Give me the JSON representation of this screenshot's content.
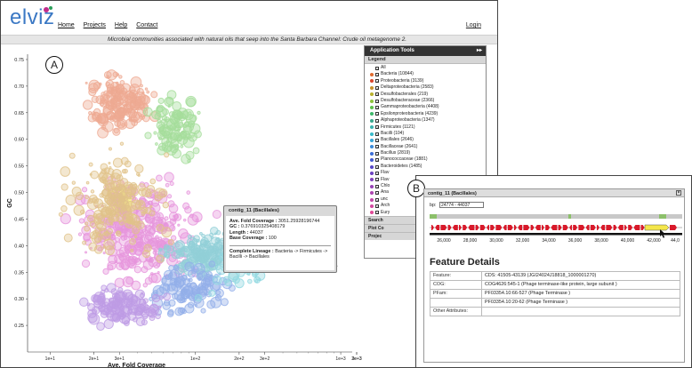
{
  "header": {
    "logo": "elviz",
    "nav": [
      "Home",
      "Projects",
      "Help",
      "Contact"
    ],
    "login": "Login",
    "subtitle": "Microbial communities associated with natural oils that seep into the Santa Barbara Channel: Crude oil metagenome 2."
  },
  "labels": {
    "a": "A",
    "b": "B"
  },
  "app_tools": {
    "title": "Application Tools",
    "arrow": "▸▸",
    "legend_title": "Legend",
    "items": [
      {
        "label": "All",
        "color": ""
      },
      {
        "label": "Bacteria (10844)",
        "color": "#e06a2e"
      },
      {
        "label": "Proteobacteria (3139)",
        "color": "#d9442a"
      },
      {
        "label": "Deltaproteobacteria (2583)",
        "color": "#c8922a"
      },
      {
        "label": "Desulfobacterales (219)",
        "color": "#b8b02c"
      },
      {
        "label": "Desulfobacteraceae (2366)",
        "color": "#8dc43a"
      },
      {
        "label": "Gammaproteobacteria (4408)",
        "color": "#5cc24a"
      },
      {
        "label": "Epsilonproteobacteria (4239)",
        "color": "#3db86a"
      },
      {
        "label": "Alphaproteobacteria (1347)",
        "color": "#3aa98f"
      },
      {
        "label": "Firmicutes (1121)",
        "color": "#39b4b0"
      },
      {
        "label": "Bacilli (104)",
        "color": "#38b9c9"
      },
      {
        "label": "Bacillales (2646)",
        "color": "#37a6d7"
      },
      {
        "label": "Bacillaceae (2641)",
        "color": "#3a8bd9"
      },
      {
        "label": "Bacillus (2819)",
        "color": "#3b6ed8"
      },
      {
        "label": "Planococcaceae (1881)",
        "color": "#4257cf"
      },
      {
        "label": "Bacteroidetes (1485)",
        "color": "#5546c6"
      },
      {
        "label": "Flav",
        "color": "#6b40c0"
      },
      {
        "label": "Flav",
        "color": "#8040bb"
      },
      {
        "label": "Chlo",
        "color": "#9642b6"
      },
      {
        "label": "Ana",
        "color": "#ad44b0"
      },
      {
        "label": "unc",
        "color": "#c246a8"
      },
      {
        "label": "Arch",
        "color": "#d348a0"
      },
      {
        "label": "Eury",
        "color": "#e04a98"
      }
    ],
    "tabs": [
      "Search",
      "Plot Co",
      "Projec"
    ]
  },
  "tooltip": {
    "title": "contig_11 (Bacillales)",
    "afc_k": "Ave. Fold Coverage :",
    "afc_v": "3051.25928196744",
    "gc_k": "GC :",
    "gc_v": "0.376910325408179",
    "len_k": "Length :",
    "len_v": "44037",
    "base_k": "Base Coverage :",
    "base_v": "100",
    "lineage_k": "Complete Lineage :",
    "lineage_v": "Bacteria -> Firmicutes -> Bacilli -> Bacillales"
  },
  "chart_data": {
    "type": "scatter",
    "title": "",
    "xlabel": "Ave. Fold Coverage",
    "ylabel": "GC",
    "x_scale": "log",
    "xlim": [
      7,
      1200
    ],
    "ylim": [
      0.2,
      0.76
    ],
    "yticks": [
      "0.25",
      "0.30",
      "0.35",
      "0.40",
      "0.45",
      "0.50",
      "0.55",
      "0.60",
      "0.65",
      "0.70",
      "0.75"
    ],
    "xticks_major": [
      "1e+1",
      "2e+1",
      "3e+1",
      "1e+2",
      "2e+2",
      "3e+2",
      "1e+3",
      "2e+3",
      "3e+3"
    ],
    "clusters": [
      {
        "name": "orange-red",
        "color": "#e0643a",
        "x": [
          16,
          60
        ],
        "y": [
          0.6,
          0.74
        ],
        "n": 180
      },
      {
        "name": "green",
        "color": "#5cc24a",
        "x": [
          40,
          130
        ],
        "y": [
          0.55,
          0.7
        ],
        "n": 110
      },
      {
        "name": "yellow",
        "color": "#f0e02a",
        "x": [
          24,
          40
        ],
        "y": [
          0.44,
          0.53
        ],
        "n": 70
      },
      {
        "name": "magenta",
        "color": "#d340c0",
        "x": [
          12,
          150
        ],
        "y": [
          0.3,
          0.55
        ],
        "n": 320
      },
      {
        "name": "teal",
        "color": "#3aa9b8",
        "x": [
          50,
          300
        ],
        "y": [
          0.33,
          0.44
        ],
        "n": 180
      },
      {
        "name": "blue",
        "color": "#3b6ed8",
        "x": [
          40,
          200
        ],
        "y": [
          0.26,
          0.38
        ],
        "n": 120
      },
      {
        "name": "purple",
        "color": "#8a4bd0",
        "x": [
          14,
          70
        ],
        "y": [
          0.24,
          0.33
        ],
        "n": 140
      },
      {
        "name": "mixed",
        "color": "#c8922a",
        "x": [
          10,
          80
        ],
        "y": [
          0.35,
          0.62
        ],
        "n": 200
      },
      {
        "name": "cyan",
        "color": "#38b9c9",
        "x": [
          100,
          400
        ],
        "y": [
          0.3,
          0.44
        ],
        "n": 60
      }
    ],
    "highlight_point": {
      "x": 800,
      "y": 0.3,
      "color": "#7fb5a8"
    }
  },
  "feature": {
    "header": "contig_11 (Bacillales)",
    "close": "×",
    "bp_label": "bp:",
    "bp_value": "24774 - 44037",
    "axis_ticks": [
      "26,000",
      "28,000",
      "30,000",
      "32,000",
      "34,000",
      "36,000",
      "38,000",
      "40,000",
      "42,000",
      "44,0"
    ],
    "title": "Feature Details",
    "rows": [
      {
        "k": "Feature:",
        "v": "CDS: 41505-43139 (JGI24024J18818_1000001270)"
      },
      {
        "k": "COG:",
        "v": "COG4626:545-1 (Phage terminase-like protein, large subunit )"
      },
      {
        "k": "PFam:",
        "v": "PF03354.10:66-527 (Phage Terminase )"
      },
      {
        "k": "",
        "v": "PF03354.10:20-62 (Phage Terminase )"
      },
      {
        "k": "Other Attributes:",
        "v": ""
      }
    ]
  }
}
